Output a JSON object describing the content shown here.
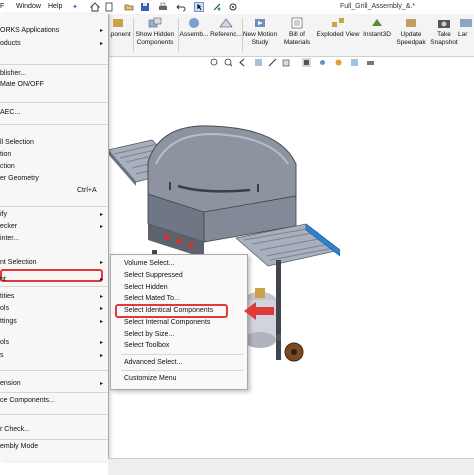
{
  "titlebar": {
    "menu_window": "Window",
    "menu_help": "Help",
    "document_title": "Full_Grill_Assembly_&.*"
  },
  "ribbon": {
    "buttons": [
      {
        "label_1": "...ponent",
        "label_2": ""
      },
      {
        "label_1": "Show Hidden",
        "label_2": "Components"
      },
      {
        "label_1": "Assemb...",
        "label_2": ""
      },
      {
        "label_1": "Referenc...",
        "label_2": ""
      },
      {
        "label_1": "New Motion",
        "label_2": "Study"
      },
      {
        "label_1": "Bill of",
        "label_2": "Materials"
      },
      {
        "label_1": "Exploded View",
        "label_2": ""
      },
      {
        "label_1": "Instant3D",
        "label_2": ""
      },
      {
        "label_1": "Update",
        "label_2": "Speedpak"
      },
      {
        "label_1": "Take",
        "label_2": "Snapshot"
      },
      {
        "label_1": "Lar",
        "label_2": ""
      }
    ]
  },
  "left_menu": {
    "items": [
      {
        "text": "ORKS Applications",
        "arrow": "▸"
      },
      {
        "text": "oducts",
        "arrow": "▸"
      },
      {
        "text": "blisher...",
        "arrow": ""
      },
      {
        "text": "Mate ON/OFF",
        "arrow": ""
      },
      {
        "text": "AEC...",
        "arrow": ""
      },
      {
        "text": "ll Selection",
        "arrow": ""
      },
      {
        "text": "tion",
        "arrow": ""
      },
      {
        "text": "ction",
        "arrow": ""
      },
      {
        "text": "er Geometry",
        "arrow": ""
      },
      {
        "text": "",
        "shortcut": "Ctrl+A",
        "arrow": ""
      },
      {
        "text": "ify",
        "arrow": "▸"
      },
      {
        "text": "ecker",
        "arrow": "▸"
      },
      {
        "text": "inter...",
        "arrow": ""
      },
      {
        "text": "nt Selection",
        "arrow": "▸"
      },
      {
        "text": "nt",
        "arrow": "▸"
      },
      {
        "text": "tities",
        "arrow": "▸"
      },
      {
        "text": "ols",
        "arrow": "▸"
      },
      {
        "text": "ttings",
        "arrow": "▸"
      },
      {
        "text": "ols",
        "arrow": "▸"
      },
      {
        "text": "s",
        "arrow": "▸"
      },
      {
        "text": "ension",
        "arrow": "▸"
      },
      {
        "text": "ce Components...",
        "arrow": ""
      },
      {
        "text": "r Check...",
        "arrow": ""
      },
      {
        "text": "embly Mode",
        "arrow": ""
      }
    ]
  },
  "submenu": {
    "items": [
      "Volume Select...",
      "Select Suppressed",
      "Select Hidden",
      "Select Mated To...",
      "Select Identical Components",
      "Select Internal Components",
      "Select by Size...",
      "Select Toolbox",
      "Advanced Select...",
      "Customize Menu"
    ]
  },
  "colors": {
    "highlight": "#e0393b",
    "grill_blue": "#2f7fd3"
  }
}
